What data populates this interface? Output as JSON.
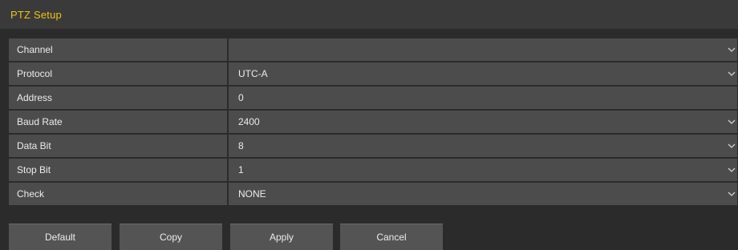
{
  "header": {
    "title": "PTZ Setup"
  },
  "colors": {
    "title": "#f0c418",
    "background": "#2b2b2b",
    "row": "#4c4c4c",
    "button": "#545454"
  },
  "fields": [
    {
      "label": "Channel",
      "value": "",
      "dropdown": true
    },
    {
      "label": "Protocol",
      "value": "UTC-A",
      "dropdown": true
    },
    {
      "label": "Address",
      "value": "0",
      "dropdown": false
    },
    {
      "label": "Baud Rate",
      "value": "2400",
      "dropdown": true
    },
    {
      "label": "Data Bit",
      "value": "8",
      "dropdown": true
    },
    {
      "label": "Stop Bit",
      "value": "1",
      "dropdown": true
    },
    {
      "label": "Check",
      "value": "NONE",
      "dropdown": true
    }
  ],
  "buttons": {
    "default": "Default",
    "copy": "Copy",
    "apply": "Apply",
    "cancel": "Cancel"
  },
  "icons": {
    "dropdown": "chevron-down-icon"
  }
}
